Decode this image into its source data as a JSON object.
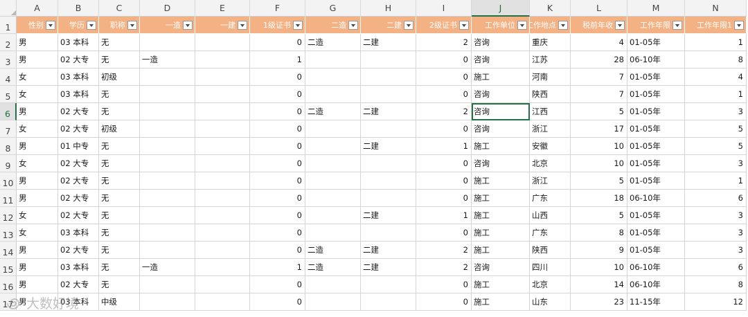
{
  "columns": [
    "A",
    "B",
    "C",
    "D",
    "E",
    "F",
    "G",
    "H",
    "I",
    "J",
    "K",
    "L",
    "M",
    "N"
  ],
  "numeric_columns": [
    5,
    8,
    11,
    13
  ],
  "active_cell": {
    "row": 5,
    "col": 9
  },
  "header_row_number": "1",
  "headers": [
    "性别",
    "学历",
    "职称",
    "一造",
    "一建",
    "1级证书",
    "二造",
    "二建",
    "2级证书",
    "工作单位",
    "工作地点",
    "税前年收",
    "工作年限",
    "工作年限1"
  ],
  "row_numbers": [
    "2",
    "3",
    "4",
    "5",
    "6",
    "7",
    "8",
    "9",
    "10",
    "11",
    "12",
    "13",
    "14",
    "15",
    "16",
    "17"
  ],
  "rows": [
    [
      "男",
      "03 本科",
      "无",
      "",
      "",
      "0",
      "二造",
      "二建",
      "2",
      "咨询",
      "重庆",
      "4",
      "01-05年",
      "1"
    ],
    [
      "男",
      "02 大专",
      "无",
      "一造",
      "",
      "1",
      "",
      "",
      "0",
      "咨询",
      "江苏",
      "28",
      "06-10年",
      "8"
    ],
    [
      "女",
      "03 本科",
      "初级",
      "",
      "",
      "0",
      "",
      "",
      "0",
      "施工",
      "河南",
      "7",
      "01-05年",
      "4"
    ],
    [
      "女",
      "03 本科",
      "无",
      "",
      "",
      "0",
      "",
      "",
      "0",
      "咨询",
      "陕西",
      "7",
      "01-05年",
      "1"
    ],
    [
      "男",
      "02 大专",
      "无",
      "",
      "",
      "0",
      "二造",
      "二建",
      "2",
      "咨询",
      "江西",
      "5",
      "01-05年",
      "3"
    ],
    [
      "女",
      "02 大专",
      "初级",
      "",
      "",
      "0",
      "",
      "",
      "0",
      "咨询",
      "浙江",
      "17",
      "01-05年",
      "5"
    ],
    [
      "男",
      "01 中专",
      "无",
      "",
      "",
      "0",
      "",
      "二建",
      "1",
      "施工",
      "安徽",
      "10",
      "01-05年",
      "5"
    ],
    [
      "女",
      "02 大专",
      "无",
      "",
      "",
      "0",
      "",
      "",
      "0",
      "咨询",
      "北京",
      "10",
      "01-05年",
      "3"
    ],
    [
      "男",
      "02 大专",
      "无",
      "",
      "",
      "0",
      "",
      "",
      "0",
      "施工",
      "浙江",
      "5",
      "01-05年",
      "1"
    ],
    [
      "男",
      "02 大专",
      "无",
      "",
      "",
      "0",
      "",
      "",
      "0",
      "施工",
      "广东",
      "18",
      "06-10年",
      "6"
    ],
    [
      "女",
      "02 大专",
      "无",
      "",
      "",
      "0",
      "",
      "二建",
      "1",
      "施工",
      "山西",
      "5",
      "01-05年",
      "3"
    ],
    [
      "女",
      "03 本科",
      "无",
      "",
      "",
      "0",
      "",
      "",
      "0",
      "施工",
      "广东",
      "8",
      "01-05年",
      "3"
    ],
    [
      "男",
      "02 大专",
      "无",
      "",
      "",
      "0",
      "二造",
      "二建",
      "2",
      "施工",
      "陕西",
      "9",
      "01-05年",
      "3"
    ],
    [
      "男",
      "03 本科",
      "无",
      "一造",
      "",
      "1",
      "二造",
      "二建",
      "2",
      "咨询",
      "四川",
      "10",
      "06-10年",
      "6"
    ],
    [
      "男",
      "02 大专",
      "无",
      "",
      "",
      "0",
      "",
      "",
      "0",
      "施工",
      "北京",
      "14",
      "06-10年",
      "8"
    ],
    [
      "男",
      "03 本科",
      "中级",
      "",
      "",
      "0",
      "",
      "",
      "0",
      "施工",
      "山东",
      "23",
      "11-15年",
      "12"
    ]
  ],
  "watermark": {
    "text": "大数好境",
    "icon": "spiral-logo-icon"
  },
  "colors": {
    "header_fill": "#f4b183",
    "selection": "#217346"
  }
}
